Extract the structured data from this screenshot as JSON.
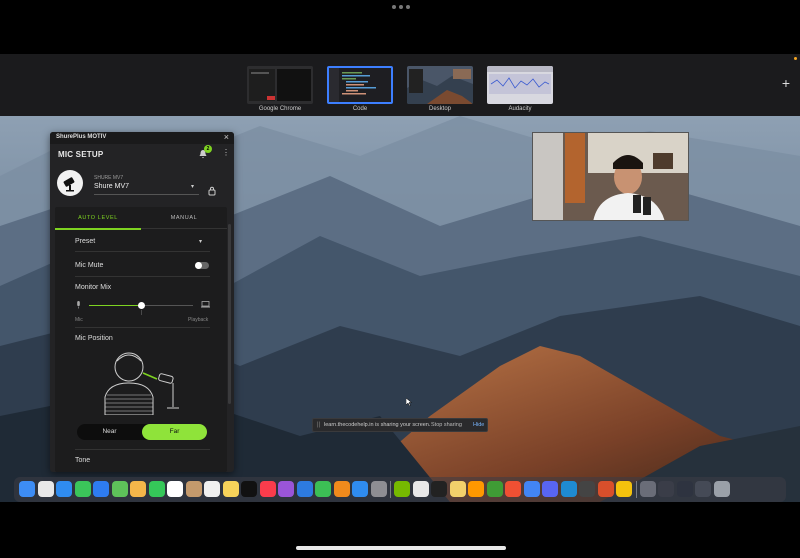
{
  "mission_control": {
    "spaces": [
      {
        "label": "Google Chrome"
      },
      {
        "label": "Code"
      },
      {
        "label": "Desktop"
      },
      {
        "label": "Audacity"
      }
    ],
    "add_space": "+"
  },
  "shure": {
    "app_title": "ShurePlus MOTIV",
    "close": "×",
    "page_title": "MIC SETUP",
    "notification_count": "2",
    "kebab": "⋮",
    "device_label": "SHURE MV7",
    "device_name": "Shure MV7",
    "tabs": {
      "auto": "AUTO LEVEL",
      "manual": "MANUAL"
    },
    "preset_label": "Preset",
    "mic_mute_label": "Mic Mute",
    "mic_mute_on": false,
    "monitor_mix_label": "Monitor Mix",
    "monitor_mix_value": 0.5,
    "mix_left": "Mic",
    "mix_right": "Playback",
    "mix_mid": "|",
    "mic_position_label": "Mic Position",
    "position_near": "Near",
    "position_far": "Far",
    "position_selected": "Far",
    "tone_label": "Tone",
    "accent_color": "#7ed321"
  },
  "share_bar": {
    "grip": "||",
    "text": "learn.thecodehelp.in is sharing your screen.",
    "stop": "Stop sharing",
    "hide": "Hide"
  },
  "dock": {
    "badges": {
      "facetime": "",
      "calendar_day": "11"
    }
  }
}
